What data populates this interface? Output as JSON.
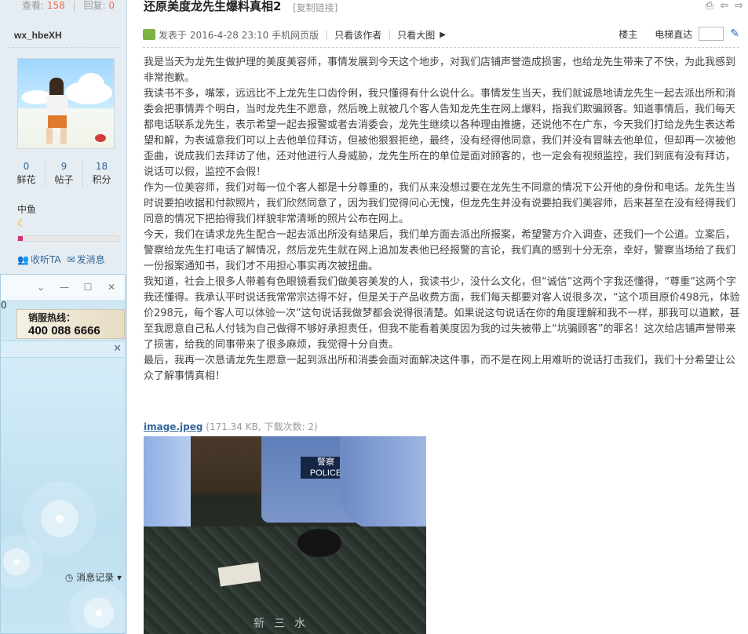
{
  "top_stats": {
    "view_label": "查看:",
    "view_count": "158",
    "reply_label": "回复:",
    "reply_count": "0"
  },
  "thread": {
    "title": "还原美度龙先生爆料真相2",
    "copy_link": "[复制链接]"
  },
  "author": {
    "name": "wx_hbeXH",
    "stats": [
      {
        "value": "0",
        "label": "鲜花"
      },
      {
        "value": "9",
        "label": "帖子"
      },
      {
        "value": "18",
        "label": "积分"
      }
    ],
    "group": "中鱼",
    "level_fraction": 0.05,
    "follow": "收听TA",
    "message": "发消息"
  },
  "meta": {
    "posted": "发表于 2016-4-28 23:10 手机网页版",
    "only_author": "只看该作者",
    "big_image": "只看大图",
    "floor": "楼主",
    "jump": "电梯直达"
  },
  "post_paragraphs": [
    "我是当天为龙先生做护理的美度美容师，事情发展到今天这个地步，对我们店铺声誉造成损害，也给龙先生带来了不快，为此我感到非常抱歉。",
    "我读书不多，嘴笨，远远比不上龙先生口齿伶俐，我只懂得有什么说什么。事情发生当天，我们就诚恳地请龙先生一起去派出所和消委会把事情弄个明白，当时龙先生不愿意，然后晚上就被几个客人告知龙先生在网上爆料，指我们欺骗顾客。知道事情后，我们每天都电话联系龙先生，表示希望一起去报警或者去消委会，龙先生继续以各种理由推搪，还说他不在广东，今天我们打给龙先生表达希望和解，为表诚意我们可以上去他单位拜访，但被他狠狠拒绝，最终，没有经得他同意，我们并没有冒昧去他单位，但却再一次被他歪曲，说成我们去拜访了他，还对他进行人身威胁，龙先生所在的单位是面对顾客的，也一定会有视频监控，我们到底有没有拜访，说话可以假，监控不会假！",
    "作为一位美容师，我们对每一位个客人都是十分尊重的，我们从来没想过要在龙先生不同意的情况下公开他的身份和电话。龙先生当时说要拍收据和付款照片，我们欣然同意了，因为我们觉得问心无愧，但龙先生并没有说要拍我们美容师，后来甚至在没有经得我们同意的情况下把拍得我们样貌非常清晰的照片公布在网上。",
    "今天，我们在请求龙先生配合一起去派出所没有结果后，我们单方面去派出所报案，希望警方介入调查，还我们一个公道。立案后，警察给龙先生打电话了解情况，然后龙先生就在网上追加发表他已经报警的言论，我们真的感到十分无奈，幸好，警察当场给了我们一份报案通知书，我们才不用担心事实再次被扭曲。",
    "我知道，社会上很多人带着有色眼镜看我们做美容美发的人，我读书少，没什么文化，但“诚信”这两个字我还懂得，“尊重”这两个字我还懂得。我承认平时说话我常常宗达得不好，但是关于产品收费方面，我们每天都要对客人说很多次，“这个项目原价498元，体验价298元，每个客人可以体验一次”这句说话我做梦都会说得很清楚。如果说这句说话在你的角度理解和我不一样，那我可以道歉，甚至我愿意自己私人付钱为自己做得不够好承担责任，但我不能看着美度因为我的过失被带上“坑骗顾客”的罪名！这次给店铺声誉带来了损害，给我的同事带来了很多麻烦，我觉得十分自责。",
    "最后，我再一次恳请龙先生愿意一起到派出所和消委会面对面解决这件事，而不是在网上用难听的说话打击我们，我们十分希望让公众了解事情真相！"
  ],
  "attachment": {
    "filename": "image.jpeg",
    "info": "(171.34 KB, 下载次数: 2)"
  },
  "photo": {
    "badge_top": "警察",
    "badge_bottom": "POLICE",
    "watermark": "新三水"
  },
  "chat": {
    "zero": "0",
    "hotline_label": "销服热线：",
    "hotline_number": "400 088 6666",
    "history": "消息记录"
  }
}
